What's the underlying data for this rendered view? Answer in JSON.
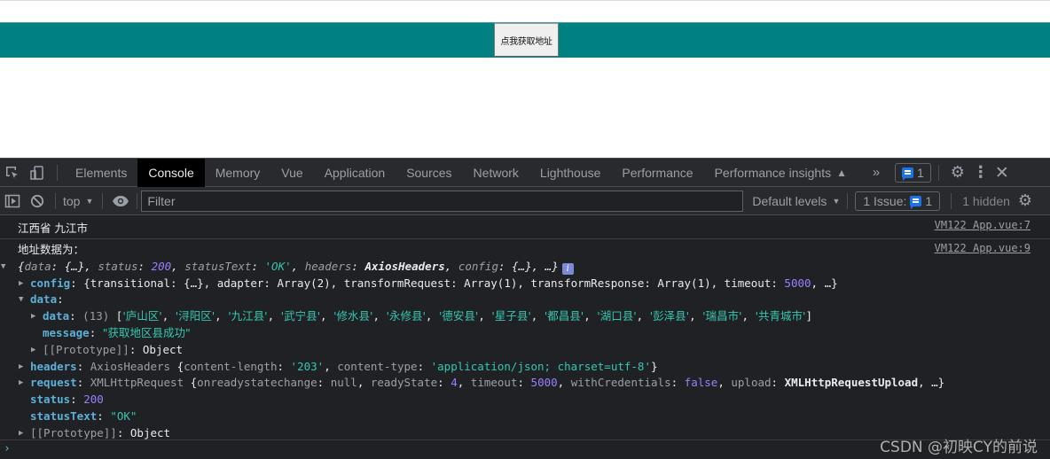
{
  "page": {
    "fetch_button_label": "点我获取地址",
    "bar_color": "#008080"
  },
  "devtools": {
    "tabs": [
      "Elements",
      "Console",
      "Memory",
      "Vue",
      "Application",
      "Sources",
      "Network",
      "Lighthouse",
      "Performance",
      "Performance insights"
    ],
    "active_tab": "Console",
    "more_tabs_label": "»",
    "issue_count_badge": "1",
    "toolbar": {
      "context": "top",
      "filter_placeholder": "Filter",
      "levels": "Default levels",
      "issues_label": "1 Issue:",
      "issues_count": "1",
      "hidden_label": "1 hidden"
    }
  },
  "console": {
    "messages": [
      {
        "text": "江西省 九江市",
        "source": "VM122 App.vue:7"
      },
      {
        "text": "地址数据为：",
        "source": "VM122 App.vue:9"
      }
    ],
    "object": {
      "summary": {
        "open": "{",
        "k1": "data",
        "v1": "{…}",
        "k2": "status",
        "v2": "200",
        "k3": "statusText",
        "v3": "'OK'",
        "k4": "headers",
        "v4": "AxiosHeaders",
        "k5": "config",
        "v5": "{…}",
        "close": ", …}"
      },
      "config": {
        "key": "config",
        "preview": "{transitional: {…}, adapter: Array(2), transformRequest: Array(1), transformResponse: Array(1), timeout: ",
        "timeout": "5000",
        "tail": ", …}"
      },
      "data": {
        "key": "data",
        "inner_key": "data",
        "count": "(13)",
        "items": [
          "庐山区",
          "浔阳区",
          "九江县",
          "武宁县",
          "修水县",
          "永修县",
          "德安县",
          "星子县",
          "都昌县",
          "湖口县",
          "彭泽县",
          "瑞昌市",
          "共青城市"
        ],
        "message_key": "message",
        "message": "\"获取地区县成功\"",
        "proto_key": "[[Prototype]]",
        "proto_val": "Object"
      },
      "headers": {
        "key": "headers",
        "type": "AxiosHeaders",
        "cl_key": "content-length",
        "cl_val": "'203'",
        "ct_key": "content-type",
        "ct_val": "'application/json; charset=utf-8'"
      },
      "request": {
        "key": "request",
        "type": "XMLHttpRequest",
        "ors_key": "onreadystatechange",
        "ors_val": "null",
        "rs_key": "readyState",
        "rs_val": "4",
        "to_key": "timeout",
        "to_val": "5000",
        "wc_key": "withCredentials",
        "wc_val": "false",
        "up_key": "upload",
        "up_val": "XMLHttpRequestUpload"
      },
      "status": {
        "key": "status",
        "value": "200"
      },
      "statusText": {
        "key": "statusText",
        "value": "\"OK\""
      },
      "proto": {
        "key": "[[Prototype]]",
        "value": "Object"
      }
    },
    "prompt": "›"
  },
  "watermark": "CSDN @初映CY的前说"
}
